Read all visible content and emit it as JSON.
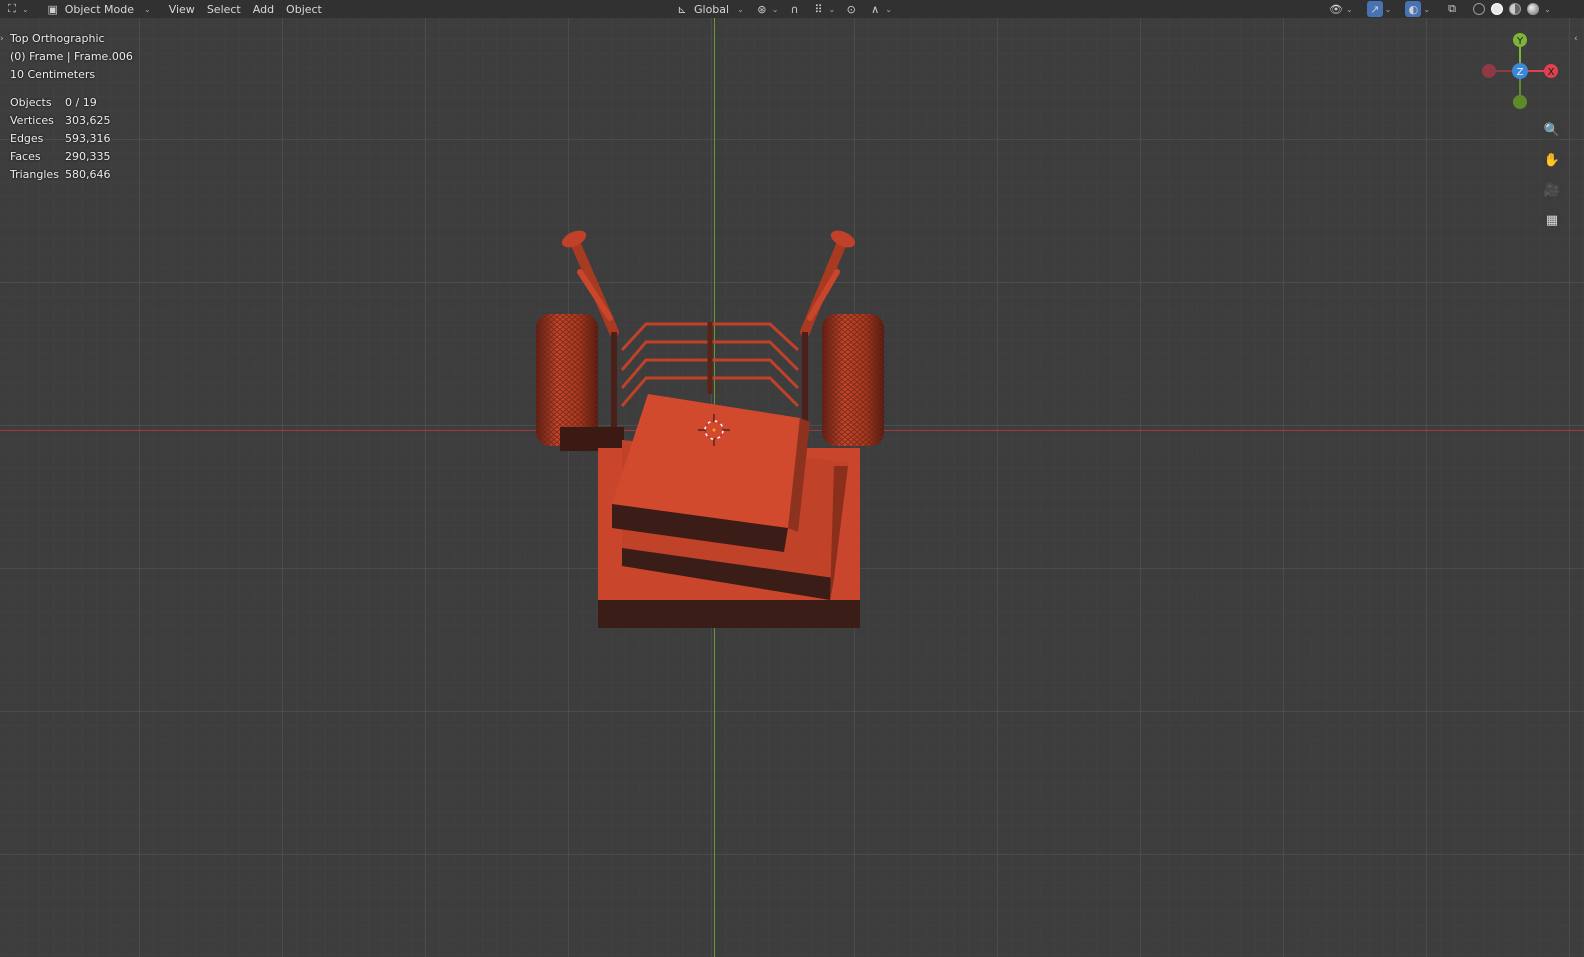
{
  "header": {
    "editor_type_icon": "viewport-editor-icon",
    "mode": "Object Mode",
    "menus": [
      "View",
      "Select",
      "Add",
      "Object"
    ],
    "transform_orientation": "Global"
  },
  "overlay": {
    "view_name": "Top Orthographic",
    "collection_info": "(0) Frame | Frame.006",
    "grid_scale": "10 Centimeters"
  },
  "stats": [
    {
      "label": "Objects",
      "value": "0 / 19"
    },
    {
      "label": "Vertices",
      "value": "303,625"
    },
    {
      "label": "Edges",
      "value": "593,316"
    },
    {
      "label": "Faces",
      "value": "290,335"
    },
    {
      "label": "Triangles",
      "value": "580,646"
    }
  ],
  "gizmo": {
    "x_label": "X",
    "y_label": "Y",
    "z_label": "Z",
    "x_color": "#e0414f",
    "y_color": "#7fb536",
    "z_color": "#3b87d8"
  },
  "nav_tools": [
    "zoom-icon",
    "hand-pan-icon",
    "camera-icon",
    "grid-ortho-icon"
  ],
  "colors": {
    "model_red": "#c9442b",
    "axis_x": "#a03a3f",
    "axis_y": "#6a9a2c"
  }
}
